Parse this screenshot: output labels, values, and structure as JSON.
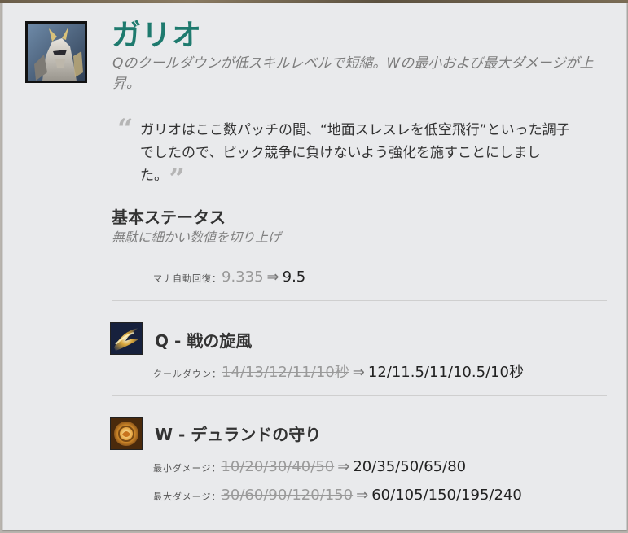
{
  "champion": {
    "name": "ガリオ",
    "summary": "Qのクールダウンが低スキルレベルで短縮。Wの最小および最大ダメージが上昇。",
    "quote": "ガリオはここ数パッチの間、“地面スレスレを低空飛行”といった調子でしたので、ピック競争に負けないよう強化を施すことにしました。",
    "quote_open": "“",
    "quote_close": "”",
    "name_color": "#1e7a6e"
  },
  "base_stats": {
    "title": "基本ステータス",
    "subtitle": "無駄に細かい数値を切り上げ",
    "rows": [
      {
        "label": "マナ自動回復：",
        "old": "9.335",
        "arrow": "⇒",
        "new": "9.5"
      }
    ]
  },
  "abilities": [
    {
      "icon": "whirlwind-icon",
      "title": "Q - 戦の旋風",
      "rows": [
        {
          "label": "クールダウン：",
          "old": "14/13/12/11/10秒",
          "arrow": "⇒",
          "new": "12/11.5/11/10.5/10秒"
        }
      ]
    },
    {
      "icon": "shield-of-durand-icon",
      "title": "W - デュランドの守り",
      "rows": [
        {
          "label": "最小ダメージ：",
          "old": "10/20/30/40/50",
          "arrow": "⇒",
          "new": "20/35/50/65/80"
        },
        {
          "label": "最大ダメージ：",
          "old": "30/60/90/120/150",
          "arrow": "⇒",
          "new": "60/105/150/195/240"
        }
      ]
    }
  ]
}
